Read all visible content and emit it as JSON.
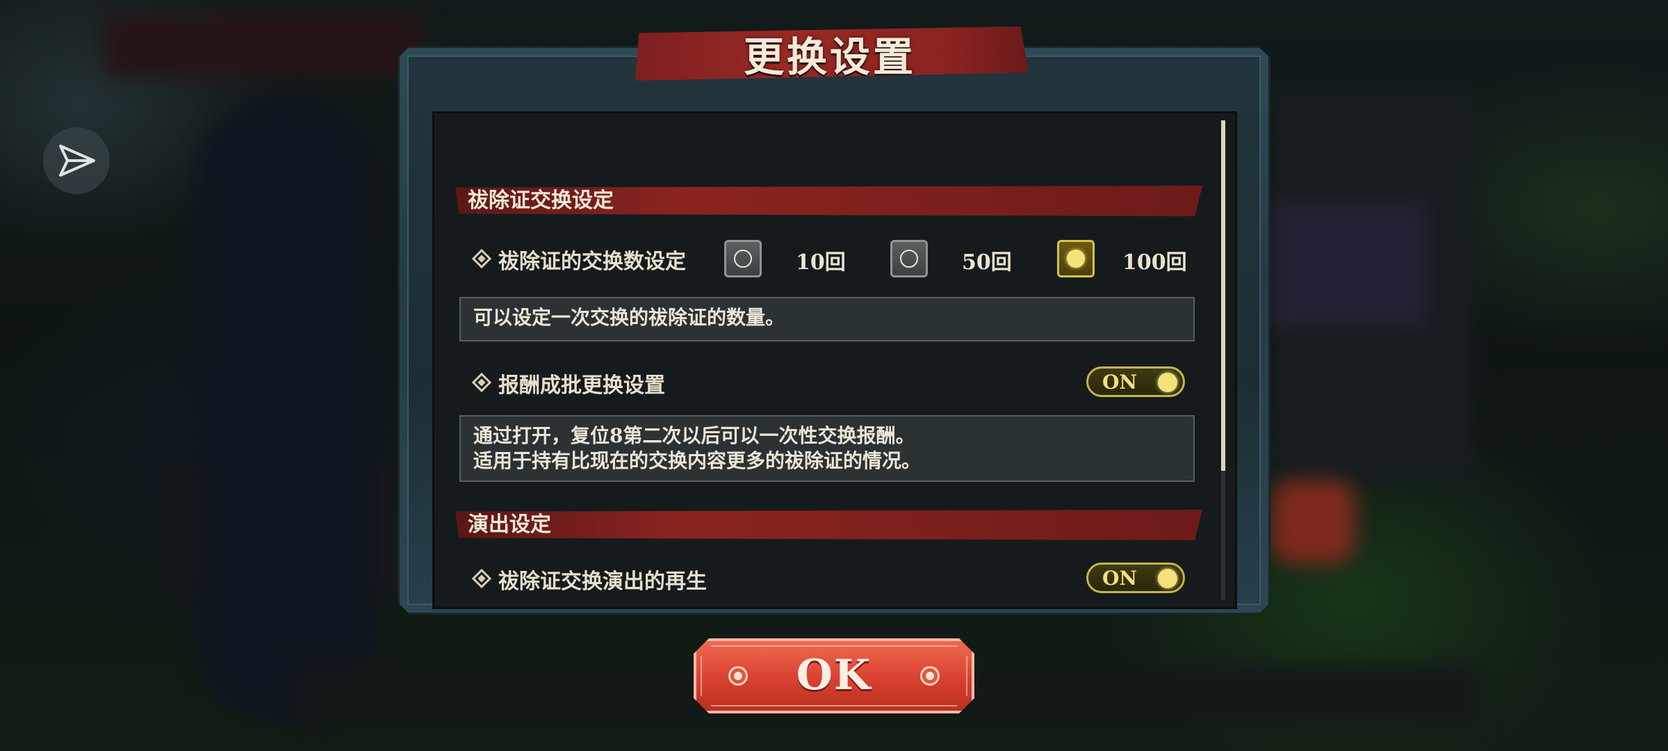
{
  "dialog": {
    "title": "更换设置",
    "sections": [
      {
        "title": "祓除证交换设定",
        "settings": [
          {
            "label": "祓除证的交换数设定",
            "options": [
              "10回",
              "50回",
              "100回"
            ],
            "selected_option": "100回",
            "description": [
              "可以设定一次交换的祓除证的数量。"
            ]
          },
          {
            "label": "报酬成批更换设置",
            "toggle": "ON",
            "description": [
              "通过打开，复位8第二次以后可以一次性交换报酬。",
              "适用于持有比现在的交换内容更多的祓除证的情况。"
            ]
          }
        ]
      },
      {
        "title": "演出设定",
        "settings": [
          {
            "label": "祓除证交换演出的再生",
            "toggle": "ON"
          }
        ]
      }
    ]
  },
  "ok_button": {
    "label": "OK"
  },
  "icons": {
    "share": "share-icon"
  },
  "colors": {
    "accent_red": "#8b2421",
    "toggle_yellow": "#f4e27a",
    "ok_red": "#d8412f"
  }
}
